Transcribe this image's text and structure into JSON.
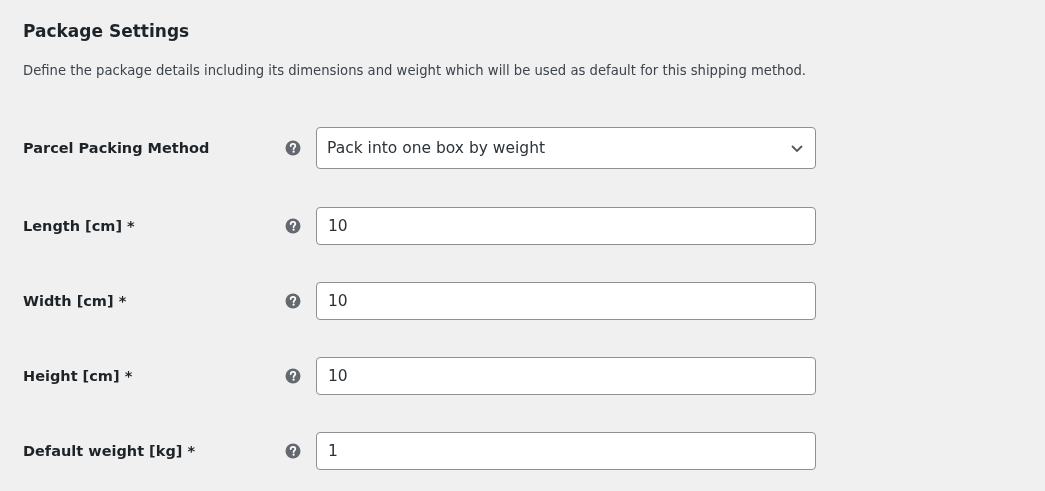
{
  "title": "Package Settings",
  "description": "Define the package details including its dimensions and weight which will be used as default for this shipping method.",
  "fields": [
    {
      "label": "Parcel Packing Method",
      "kind": "select",
      "value": "Pack into one box by weight"
    },
    {
      "label": "Length [cm] *",
      "kind": "text",
      "value": "10"
    },
    {
      "label": "Width [cm] *",
      "kind": "text",
      "value": "10"
    },
    {
      "label": "Height [cm] *",
      "kind": "text",
      "value": "10"
    },
    {
      "label": "Default weight [kg] *",
      "kind": "text",
      "value": "1"
    }
  ]
}
